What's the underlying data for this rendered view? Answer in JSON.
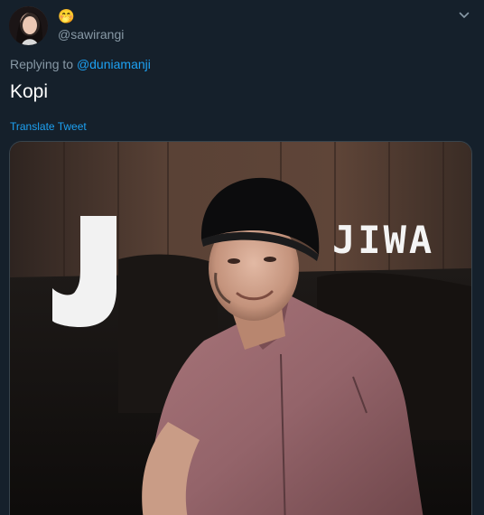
{
  "tweet": {
    "display_name": "🤭",
    "handle": "@sawirangi",
    "replying_prefix": "Replying to",
    "replying_to": "@duniamanji",
    "text": "Kopi",
    "translate_label": "Translate Tweet",
    "more_icon": "chevron-down-icon"
  },
  "media": {
    "logo_letter": "J",
    "caption": "JIWA"
  },
  "colors": {
    "background": "#15202b",
    "link": "#1da1f2",
    "muted": "#8899a6",
    "text": "#ffffff",
    "border": "#38444d"
  }
}
